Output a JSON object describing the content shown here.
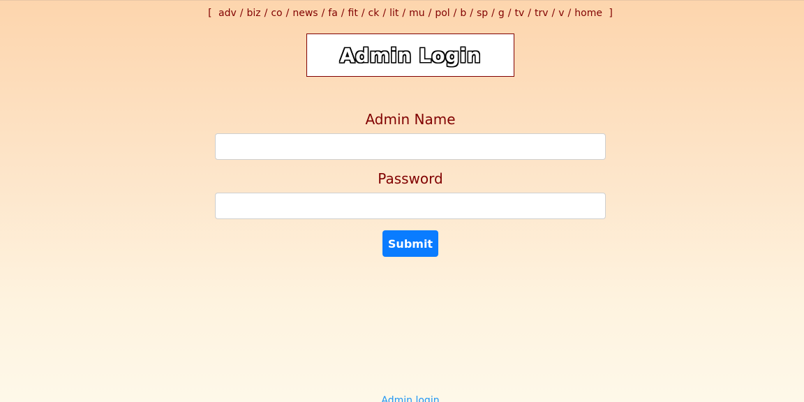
{
  "nav": {
    "open_bracket": "[",
    "close_bracket": "]",
    "separator": "/",
    "links": [
      "adv",
      "biz",
      "co",
      "news",
      "fa",
      "fit",
      "ck",
      "lit",
      "mu",
      "pol",
      "b",
      "sp",
      "g",
      "tv",
      "trv",
      "v",
      "home"
    ]
  },
  "header": {
    "title": "Admin Login"
  },
  "form": {
    "name_label": "Admin Name",
    "name_value": "",
    "password_label": "Password",
    "password_value": "",
    "submit_label": "Submit"
  },
  "footer": {
    "link_text": "Admin login"
  },
  "colors": {
    "text": "#800000",
    "button": "#0a7cff",
    "link": "#2196f3"
  }
}
